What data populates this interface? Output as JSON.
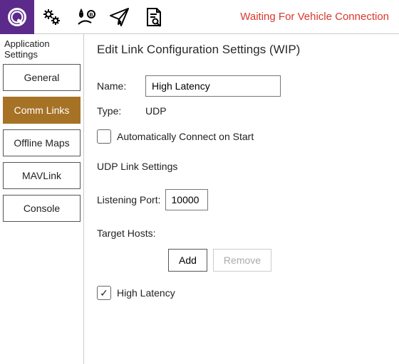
{
  "toolbar": {
    "status_text": "Waiting For Vehicle Connection"
  },
  "sidebar": {
    "title": "Application Settings",
    "items": [
      {
        "label": "General",
        "active": false
      },
      {
        "label": "Comm Links",
        "active": true
      },
      {
        "label": "Offline Maps",
        "active": false
      },
      {
        "label": "MAVLink",
        "active": false
      },
      {
        "label": "Console",
        "active": false
      }
    ]
  },
  "main": {
    "title": "Edit Link Configuration Settings (WIP)",
    "name_label": "Name:",
    "name_value": "High Latency",
    "type_label": "Type:",
    "type_value": "UDP",
    "auto_connect_label": "Automatically Connect on Start",
    "auto_connect_checked": false,
    "udp_section_title": "UDP Link Settings",
    "listening_port_label": "Listening Port:",
    "listening_port_value": "10000",
    "target_hosts_label": "Target Hosts:",
    "add_label": "Add",
    "remove_label": "Remove",
    "high_latency_label": "High Latency",
    "high_latency_checked": true
  }
}
